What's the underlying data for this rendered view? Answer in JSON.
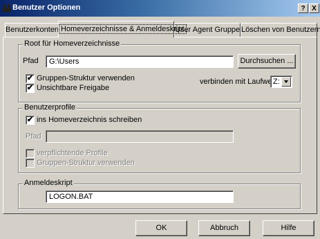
{
  "window": {
    "title": "Benutzer Optionen",
    "help_glyph": "?",
    "close_glyph": "X"
  },
  "tabs": [
    {
      "label": "Benutzerkonten",
      "active": false
    },
    {
      "label": "Homeverzeichnisse & Anmeldeskript",
      "active": true
    },
    {
      "label": "User Agent Gruppen",
      "active": false
    },
    {
      "label": "Löschen von Benutzern",
      "active": false
    }
  ],
  "root_group": {
    "title": "Root für Homeverzeichnisse",
    "path_label": "Pfad",
    "path_value": "G:\\Users",
    "browse_button": "Durchsuchen ...",
    "checkbox_group_structure": {
      "label": "Gruppen-Struktur verwenden",
      "checked": true
    },
    "checkbox_hidden_shares": {
      "label": "Unsichtbare Freigabe",
      "checked": true
    },
    "drive_label": "verbinden mit Laufwerk",
    "drive_value": "Z:"
  },
  "profile_group": {
    "title": "Benutzerprofile",
    "checkbox_write_home": {
      "label": "ins Homeverzeichnis schreiben",
      "checked": true
    },
    "path_label": "Pfad",
    "path_value": "",
    "checkbox_mandatory": {
      "label": "verpflichtende Profile",
      "checked": false
    },
    "checkbox_group_structure": {
      "label": "Gruppen-Struktur verwenden",
      "checked": false
    }
  },
  "logon_group": {
    "title": "Anmeldeskript",
    "script_value": "LOGON.BAT"
  },
  "footer": {
    "ok": "OK",
    "cancel": "Abbruch",
    "help": "Hilfe"
  },
  "check_glyph": "✔"
}
